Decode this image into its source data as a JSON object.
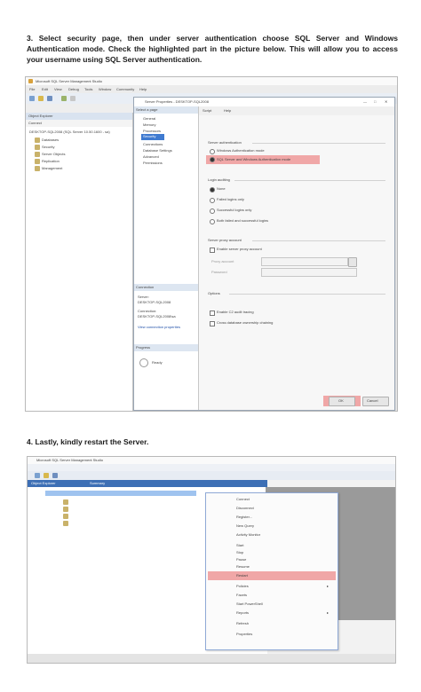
{
  "instructions": {
    "step3": "3. Select security page, then under server authentication choose SQL Server and Windows Authentication mode. Check the highlighted part in the picture below. This will allow you to access your username using SQL Server authentication.",
    "step4": "4. Lastly, kindly restart the Server."
  },
  "screenshot1": {
    "app_title": "Microsoft SQL Server Management Studio",
    "menu": [
      "File",
      "Edit",
      "View",
      "Debug",
      "Tools",
      "Window",
      "Community",
      "Help"
    ],
    "explorer_title": "Object Explorer",
    "connect_label": "Connect",
    "tree_root": "DESKTOP-SQL2008 (SQL Server 10.50.1600 - sa)",
    "tree_items": [
      "Databases",
      "Security",
      "Server Objects",
      "Replication",
      "Management"
    ],
    "dialog_title": "Server Properties - DESKTOP-SQL2008",
    "select_page_title": "Select a page",
    "pages": [
      "General",
      "Memory",
      "Processors",
      "Security",
      "Connections",
      "Database Settings",
      "Advanced",
      "Permissions"
    ],
    "toolbar_script": "Script",
    "toolbar_help": "Help",
    "server_auth_label": "Server authentication",
    "auth_windows": "Windows Authentication mode",
    "auth_mixed": "SQL Server and Windows Authentication mode",
    "login_auditing_label": "Login auditing",
    "audit_options": [
      "None",
      "Failed logins only",
      "Successful logins only",
      "Both failed and successful logins"
    ],
    "proxy_label": "Server proxy account",
    "proxy_enable": "Enable server proxy account",
    "proxy_account": "Proxy account",
    "proxy_password": "Password",
    "options_label": "Options",
    "option_items": [
      "Enable C2 audit tracing",
      "Cross database ownership chaining"
    ],
    "connection_title": "Connection",
    "connection_server_label": "Server:",
    "connection_server": "DESKTOP-SQL2008",
    "connection_user_label": "Connection:",
    "connection_user": "DESKTOP-SQL2008\\sa",
    "view_props": "View connection properties",
    "progress_title": "Progress",
    "progress_status": "Ready",
    "ok": "OK",
    "cancel": "Cancel"
  },
  "screenshot2": {
    "title": "Microsoft SQL Server Management Studio",
    "tabs": [
      "Object Explorer",
      "Summary"
    ],
    "context_menu": [
      "Connect",
      "Disconnect",
      "Register...",
      "New Query",
      "Activity Monitor",
      "Start",
      "Stop",
      "Pause",
      "Resume",
      "Restart",
      "Policies",
      "Facets",
      "Start PowerShell",
      "Reports",
      "Refresh",
      "Properties"
    ],
    "highlighted_item": "Restart",
    "highlight_color": "#f0a7a7"
  }
}
